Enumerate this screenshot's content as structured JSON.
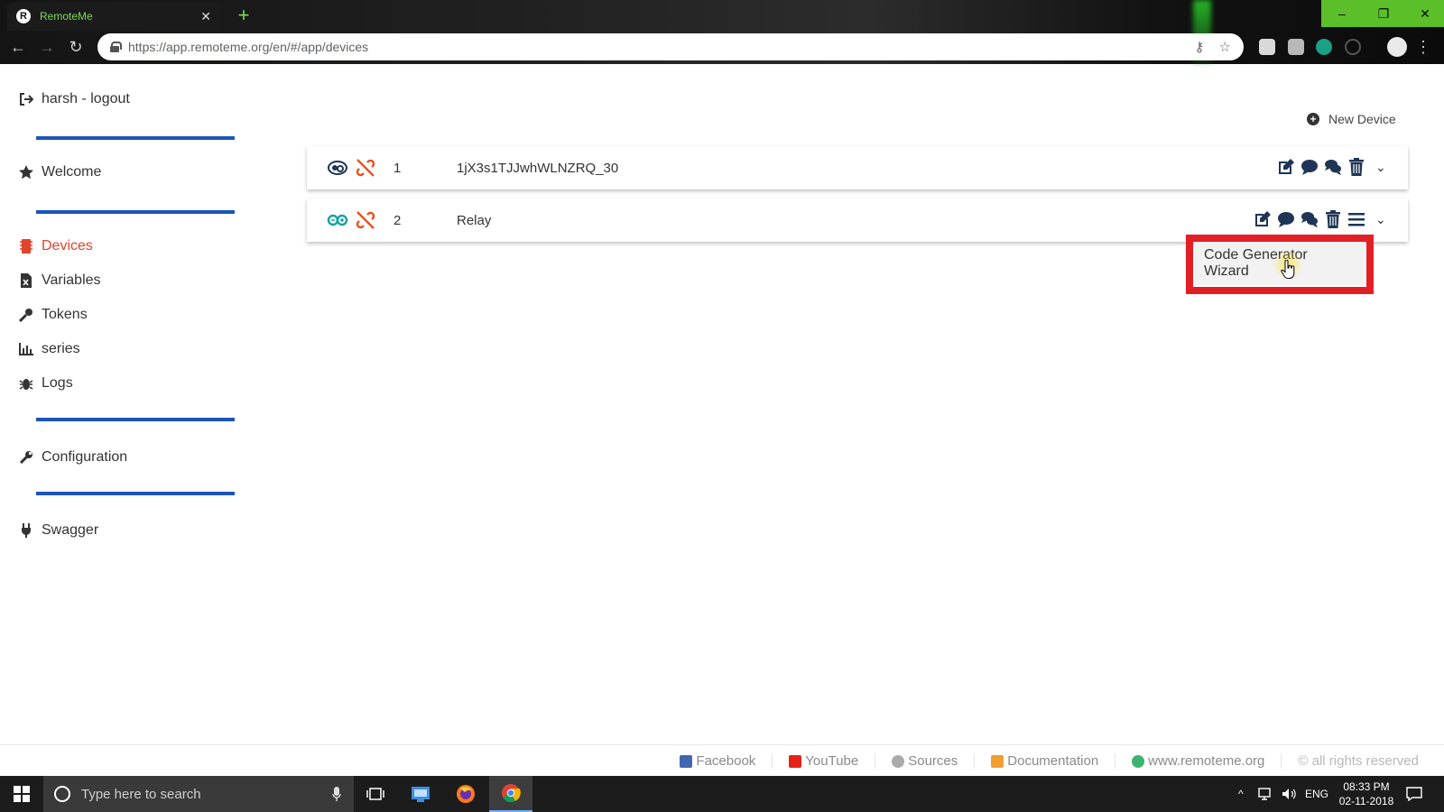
{
  "browser": {
    "tab_title": "RemoteMe",
    "tab_favicon_letter": "R",
    "url": "https://app.remoteme.org/en/#/app/devices",
    "window_controls": {
      "minimize": "–",
      "maximize": "❐",
      "close": "✕"
    }
  },
  "sidebar": {
    "user": "harsh - logout",
    "items": [
      {
        "label": "Welcome",
        "icon": "star-icon"
      },
      {
        "label": "Devices",
        "icon": "devices-icon",
        "active": true
      },
      {
        "label": "Variables",
        "icon": "variables-icon"
      },
      {
        "label": "Tokens",
        "icon": "key-icon"
      },
      {
        "label": "series",
        "icon": "bar-chart-icon"
      },
      {
        "label": "Logs",
        "icon": "bug-icon"
      },
      {
        "label": "Configuration",
        "icon": "wrench-icon"
      },
      {
        "label": "Swagger",
        "icon": "plug-icon"
      }
    ]
  },
  "main": {
    "new_device_label": "New Device",
    "devices": [
      {
        "id": "1",
        "name": "1jX3s1TJJwhWLNZRQ_30",
        "type_icon": "webpage-device-icon",
        "connection_icon": "disconnected-icon"
      },
      {
        "id": "2",
        "name": "Relay",
        "type_icon": "arduino-device-icon",
        "connection_icon": "disconnected-icon"
      }
    ],
    "dropdown_menu": {
      "item": "Code Generator Wizard"
    }
  },
  "footer": {
    "links": [
      {
        "label": "Facebook",
        "icon": "facebook-icon",
        "color": "#4267b2"
      },
      {
        "label": "YouTube",
        "icon": "youtube-icon",
        "color": "#e62117"
      },
      {
        "label": "Sources",
        "icon": "github-icon",
        "color": "#aaaaaa"
      },
      {
        "label": "Documentation",
        "icon": "book-icon",
        "color": "#f0a030"
      },
      {
        "label": "www.remoteme.org",
        "icon": "globe-icon",
        "color": "#3cb371"
      },
      {
        "label": "© all rights reserved",
        "icon": "",
        "color": ""
      }
    ]
  },
  "taskbar": {
    "search_placeholder": "Type here to search",
    "language": "ENG",
    "time": "08:33 PM",
    "date": "02-11-2018"
  },
  "colors": {
    "accent_active": "#e0442b",
    "divider_blue": "#1a56b8",
    "highlight_red": "#e31f26",
    "action_icon": "#1f3556"
  }
}
